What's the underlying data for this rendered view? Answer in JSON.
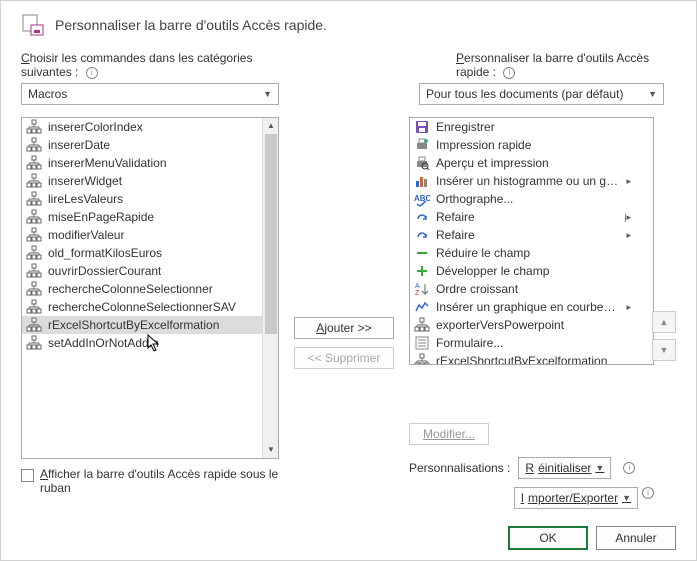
{
  "header": {
    "title": "Personnaliser la barre d'outils Accès rapide."
  },
  "left_label": "Choisir les commandes dans les catégories suivantes :",
  "right_label": "Personnaliser la barre d'outils Accès rapide :",
  "left_select": "Macros",
  "right_select": "Pour tous les documents (par défaut)",
  "left_items": [
    {
      "label": "insererColorIndex",
      "selected": false
    },
    {
      "label": "insererDate",
      "selected": false
    },
    {
      "label": "insererMenuValidation",
      "selected": false
    },
    {
      "label": "insererWidget",
      "selected": false
    },
    {
      "label": "lireLesValeurs",
      "selected": false
    },
    {
      "label": "miseEnPageRapide",
      "selected": false
    },
    {
      "label": "modifierValeur",
      "selected": false
    },
    {
      "label": "old_formatKilosEuros",
      "selected": false
    },
    {
      "label": "ouvrirDossierCourant",
      "selected": false
    },
    {
      "label": "rechercheColonneSelectionner",
      "selected": false
    },
    {
      "label": "rechercheColonneSelectionnerSAV",
      "selected": false
    },
    {
      "label": "rExcelShortcutByExcelformation",
      "selected": true
    },
    {
      "label": "setAddInOrNotAddIn",
      "selected": false
    }
  ],
  "right_items": [
    {
      "label": "Enregistrer",
      "icon": "save",
      "arrow": false
    },
    {
      "label": "Impression rapide",
      "icon": "quickprint",
      "arrow": false
    },
    {
      "label": "Aperçu et impression",
      "icon": "preview",
      "arrow": false
    },
    {
      "label": "Insérer un histogramme ou un gra...",
      "icon": "barchart",
      "arrow": true
    },
    {
      "label": "Orthographe...",
      "icon": "spell",
      "arrow": false
    },
    {
      "label": "Refaire",
      "icon": "redo",
      "arrow": true,
      "arrowbar": true
    },
    {
      "label": "Refaire",
      "icon": "redo",
      "arrow": true
    },
    {
      "label": "Réduire le champ",
      "icon": "collapse",
      "arrow": false
    },
    {
      "label": "Développer le champ",
      "icon": "expand",
      "arrow": false
    },
    {
      "label": "Ordre croissant",
      "icon": "sortasc",
      "arrow": false
    },
    {
      "label": "Insérer un graphique en courbes o...",
      "icon": "linechart",
      "arrow": true
    },
    {
      "label": "exporterVersPowerpoint",
      "icon": "macro",
      "arrow": false
    },
    {
      "label": "Formulaire...",
      "icon": "form",
      "arrow": false
    },
    {
      "label": "rExcelShortcutByExcelformation",
      "icon": "macro",
      "arrow": false
    }
  ],
  "btn_add": "Ajouter >>",
  "btn_remove": "<< Supprimer",
  "checkbox_label": "Afficher la barre d'outils Accès rapide sous le ruban",
  "btn_modifier": "Modifier...",
  "perso_label": "Personnalisations :",
  "btn_reset": "Réinitialiser",
  "btn_import": "Importer/Exporter",
  "btn_ok": "OK",
  "btn_cancel": "Annuler"
}
